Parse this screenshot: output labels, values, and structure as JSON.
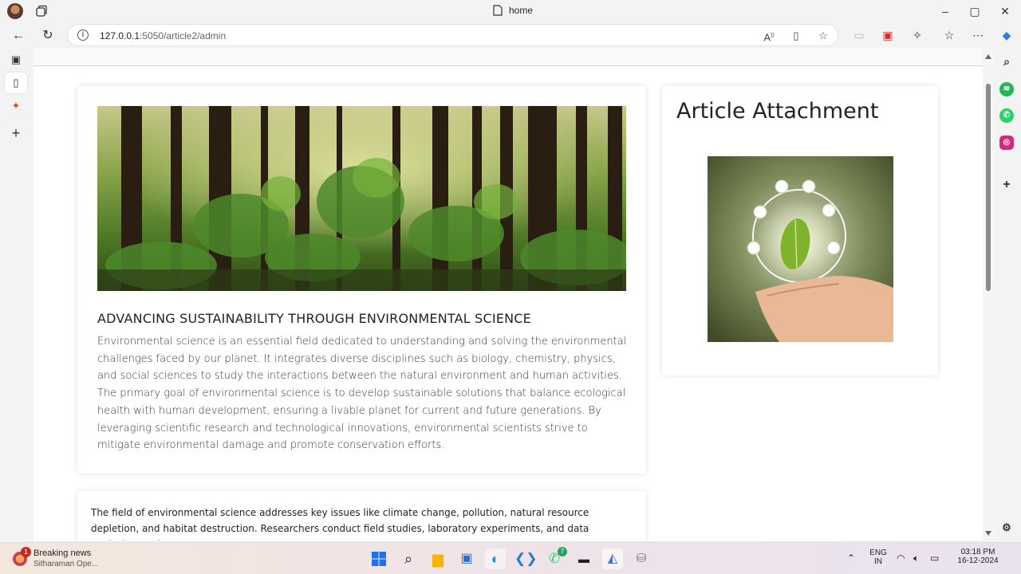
{
  "browser": {
    "tab_title": "home",
    "url_host": "127.0.0.1",
    "url_rest": ":5050/article2/admin"
  },
  "article": {
    "title": "ADVANCING SUSTAINABILITY THROUGH ENVIRONMENTAL SCIENCE",
    "body": "Environmental science is an essential field dedicated to understanding and solving the environmental challenges faced by our planet. It integrates diverse disciplines such as biology, chemistry, physics, and social sciences to study the interactions between the natural environment and human activities. The primary goal of environmental science is to develop sustainable solutions that balance ecological health with human development, ensuring a livable planet for current and future generations. By leveraging scientific research and technological innovations, environmental scientists strive to mitigate environmental damage and promote conservation efforts."
  },
  "sidebar": {
    "title": "Article Attachment"
  },
  "second_card": {
    "body": "The field of environmental science addresses key issues like climate change, pollution, natural resource depletion, and habitat destruction. Researchers conduct field studies, laboratory experiments, and data analysis to gain"
  },
  "taskbar": {
    "news_headline": "Breaking news",
    "news_sub": "Sitharaman Ope...",
    "news_badge": "1",
    "whatsapp_badge": "7",
    "lang_top": "ENG",
    "lang_bottom": "IN",
    "time": "03:18 PM",
    "date": "16-12-2024"
  }
}
